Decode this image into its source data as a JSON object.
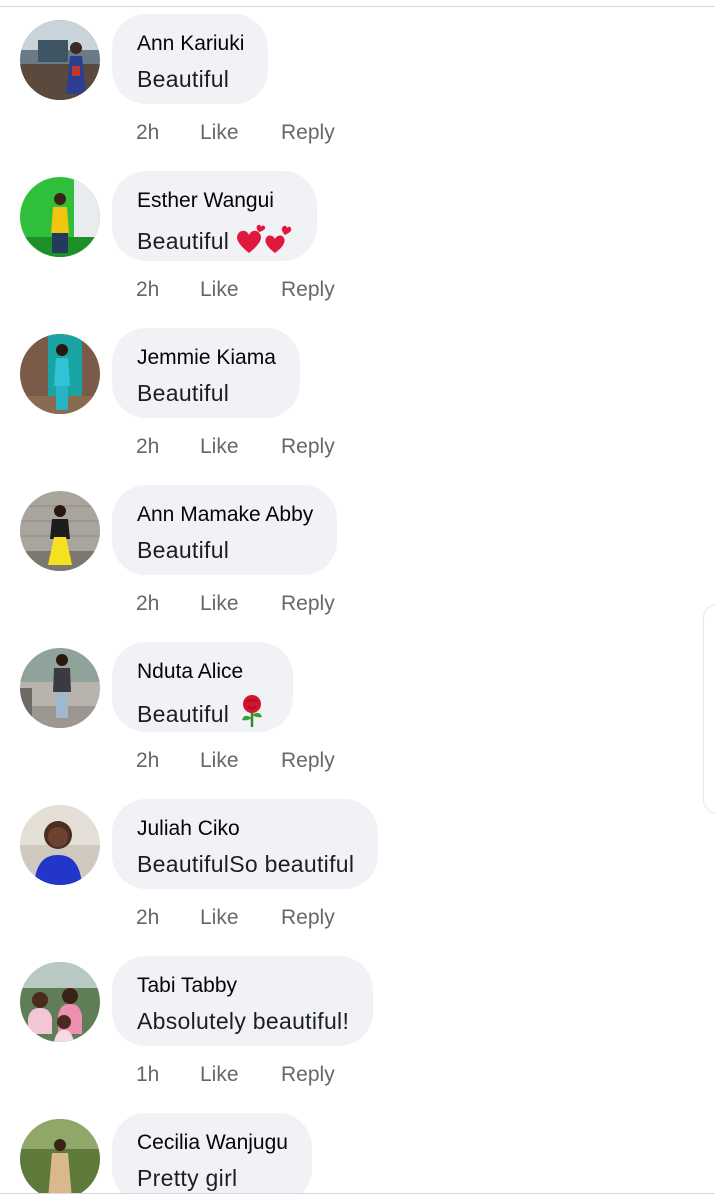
{
  "comments": [
    {
      "author": "Ann Kariuki",
      "text": "Beautiful",
      "emoji": "",
      "time": "2h",
      "avatar": "photo-woman-blue-dress"
    },
    {
      "author": "Esther Wangui",
      "text": "Beautiful",
      "emoji": "hearts",
      "time": "2h",
      "avatar": "photo-woman-green-wall"
    },
    {
      "author": "Jemmie Kiama",
      "text": "Beautiful",
      "emoji": "",
      "time": "2h",
      "avatar": "photo-woman-teal-door"
    },
    {
      "author": "Ann Mamake Abby",
      "text": "Beautiful",
      "emoji": "",
      "time": "2h",
      "avatar": "photo-woman-yellow-dress"
    },
    {
      "author": "Nduta Alice",
      "text": "Beautiful",
      "emoji": "rose",
      "time": "2h",
      "avatar": "photo-woman-outdoor"
    },
    {
      "author": "Juliah Ciko",
      "text": "BeautifulSo beautiful",
      "emoji": "",
      "time": "2h",
      "avatar": "photo-woman-blue-top"
    },
    {
      "author": "Tabi Tabby",
      "text": "Absolutely beautiful!",
      "emoji": "",
      "time": "1h",
      "avatar": "photo-group-pink"
    },
    {
      "author": "Cecilia Wanjugu",
      "text": "Pretty girl",
      "emoji": "",
      "time": "",
      "avatar": "photo-woman-garden"
    }
  ],
  "actions": {
    "like_label": "Like",
    "reply_label": "Reply"
  },
  "colors": {
    "bubble": "#f0f2f5",
    "meta_text": "#65676b",
    "name_text": "#050505"
  }
}
